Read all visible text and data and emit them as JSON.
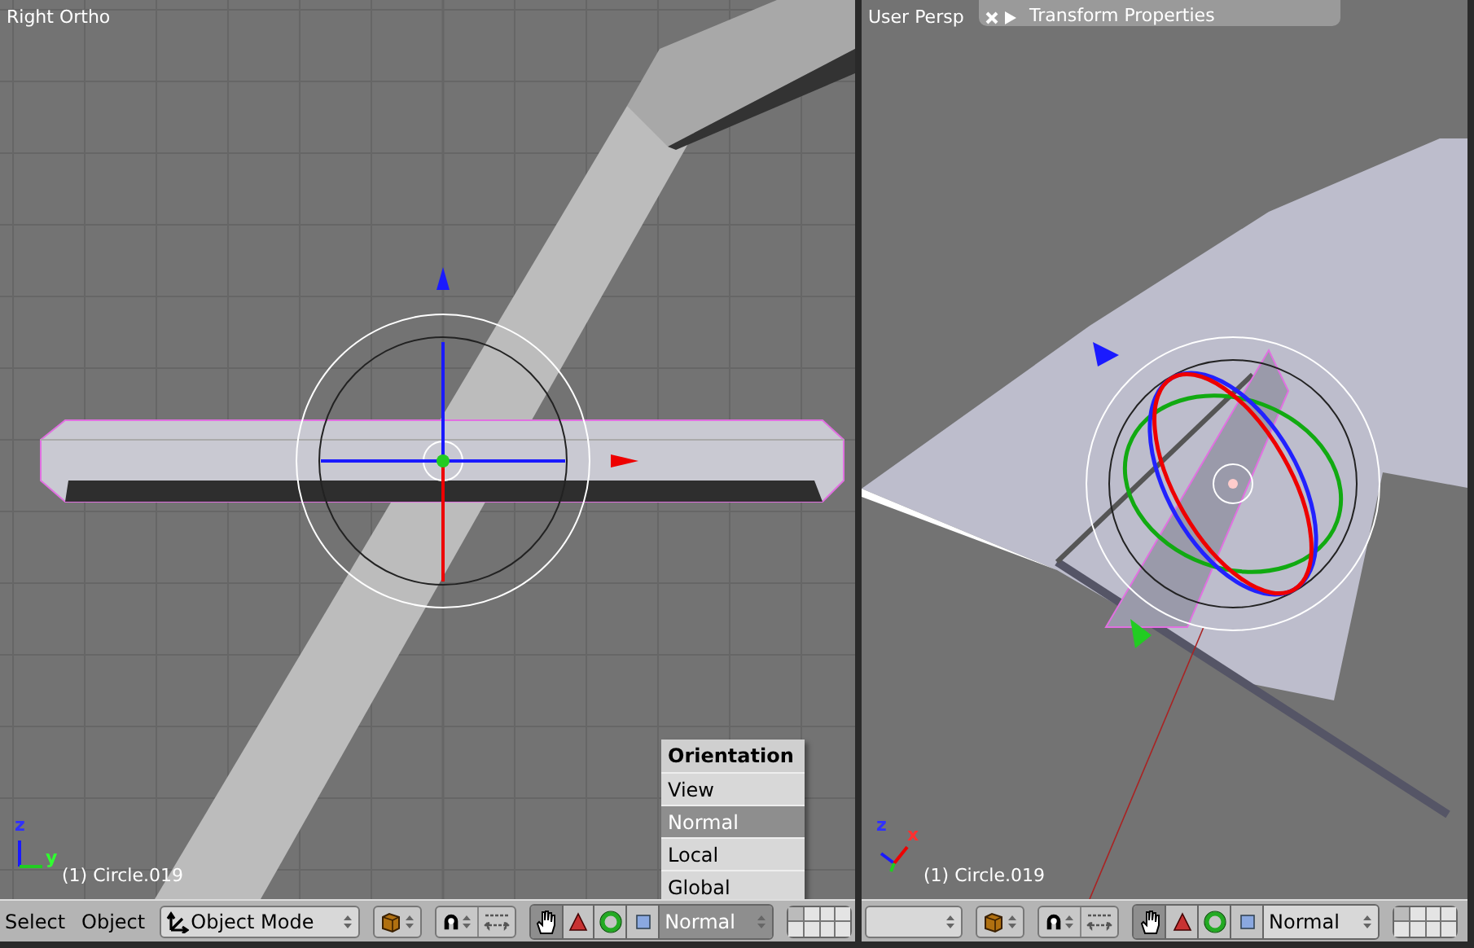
{
  "viewports": [
    {
      "kind": "ortho",
      "view_name": "Right Ortho",
      "object_info": "(1) Circle.019",
      "axes": [
        "z",
        "y"
      ],
      "header": {
        "menus": [
          "Select",
          "Object"
        ],
        "mode": "Object Mode",
        "orientation": "Normal",
        "orientation_open": true,
        "manipulators": [
          {
            "kind": "hand",
            "selected": true
          },
          {
            "kind": "translate",
            "selected": false
          },
          {
            "kind": "rotate",
            "selected": false
          },
          {
            "kind": "scale",
            "selected": false
          }
        ]
      }
    },
    {
      "kind": "persp",
      "view_name": "User Persp",
      "object_info": "(1) Circle.019",
      "axes": [
        "z",
        "x"
      ],
      "panel": {
        "title": "Transform Properties"
      },
      "header": {
        "orientation": "Normal",
        "orientation_open": false,
        "manipulators": [
          {
            "kind": "hand",
            "selected": true
          },
          {
            "kind": "translate",
            "selected": false
          },
          {
            "kind": "rotate",
            "selected": false
          },
          {
            "kind": "scale",
            "selected": false
          }
        ]
      }
    }
  ],
  "orientation_menu": {
    "title": "Orientation",
    "items": [
      {
        "label": "View",
        "selected": false
      },
      {
        "label": "Normal",
        "selected": true
      },
      {
        "label": "Local",
        "selected": false
      },
      {
        "label": "Global",
        "selected": false
      }
    ]
  }
}
